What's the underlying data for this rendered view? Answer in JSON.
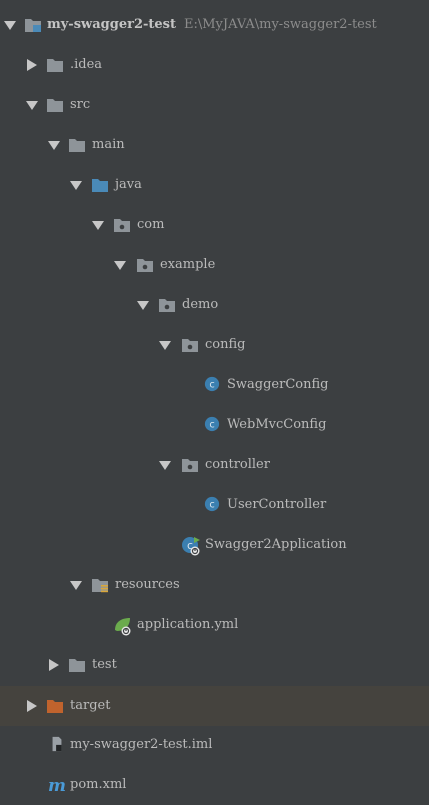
{
  "colors": {
    "background": "#3c3f41",
    "highlight_row": "#45433e",
    "folder_gray": "#8e9499",
    "folder_blue": "#4a8ab8",
    "folder_orange": "#c0632d",
    "class_icon": "#3b7fb0",
    "spring_green": "#6bab4d"
  },
  "tree": {
    "root": {
      "name": "my-swagger2-test",
      "path": "E:\\MyJAVA\\my-swagger2-test"
    },
    "items": [
      {
        "label": ".idea",
        "icon": "folder-icon"
      },
      {
        "label": "src",
        "icon": "folder-icon"
      },
      {
        "label": "main",
        "icon": "folder-icon"
      },
      {
        "label": "java",
        "icon": "source-folder-icon"
      },
      {
        "label": "com",
        "icon": "package-icon"
      },
      {
        "label": "example",
        "icon": "package-icon"
      },
      {
        "label": "demo",
        "icon": "package-icon"
      },
      {
        "label": "config",
        "icon": "package-icon"
      },
      {
        "label": "SwaggerConfig",
        "icon": "class-icon"
      },
      {
        "label": "WebMvcConfig",
        "icon": "class-icon"
      },
      {
        "label": "controller",
        "icon": "package-icon"
      },
      {
        "label": "UserController",
        "icon": "class-icon"
      },
      {
        "label": "Swagger2Application",
        "icon": "spring-boot-class-icon"
      },
      {
        "label": "resources",
        "icon": "resources-folder-icon"
      },
      {
        "label": "application.yml",
        "icon": "spring-config-icon"
      },
      {
        "label": "test",
        "icon": "folder-icon"
      },
      {
        "label": "target",
        "icon": "excluded-folder-icon"
      },
      {
        "label": "my-swagger2-test.iml",
        "icon": "module-file-icon"
      },
      {
        "label": "pom.xml",
        "icon": "maven-icon"
      }
    ]
  }
}
